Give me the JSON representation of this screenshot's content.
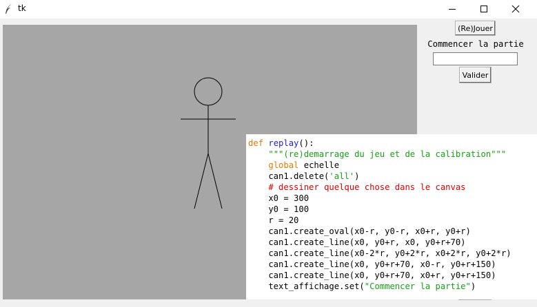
{
  "window": {
    "title": "tk"
  },
  "controls": {
    "replay_label": "(Re)Jouer",
    "status_text": "Commencer la partie",
    "entry_value": "",
    "validate_label": "Valider"
  },
  "code": {
    "lines": [
      [
        {
          "t": "def ",
          "c": "kw"
        },
        {
          "t": "replay",
          "c": "fn"
        },
        {
          "t": "():",
          "c": ""
        }
      ],
      [
        {
          "t": "    ",
          "c": ""
        },
        {
          "t": "\"\"\"(re)demarrage du jeu et de la calibration\"\"\"",
          "c": "str"
        }
      ],
      [
        {
          "t": "    ",
          "c": ""
        },
        {
          "t": "global",
          "c": "kw"
        },
        {
          "t": " echelle",
          "c": ""
        }
      ],
      [
        {
          "t": "    can1.delete(",
          "c": ""
        },
        {
          "t": "'all'",
          "c": "str"
        },
        {
          "t": ")",
          "c": ""
        }
      ],
      [
        {
          "t": "    ",
          "c": ""
        },
        {
          "t": "# dessiner quelque chose dans le canvas",
          "c": "cm"
        }
      ],
      [
        {
          "t": "    x0 = 300",
          "c": ""
        }
      ],
      [
        {
          "t": "    y0 = 100",
          "c": ""
        }
      ],
      [
        {
          "t": "    r = 20",
          "c": ""
        }
      ],
      [
        {
          "t": "    can1.create_oval(x0-r, y0-r, x0+r, y0+r)",
          "c": ""
        }
      ],
      [
        {
          "t": "    can1.create_line(x0, y0+r, x0, y0+r+70)",
          "c": ""
        }
      ],
      [
        {
          "t": "    can1.create_line(x0-2*r, y0+2*r, x0+2*r, y0+2*r)",
          "c": ""
        }
      ],
      [
        {
          "t": "    can1.create_line(x0, y0+r+70, x0-r, y0+r+150)",
          "c": ""
        }
      ],
      [
        {
          "t": "    can1.create_line(x0, y0+r+70, x0+r, y0+r+150)",
          "c": ""
        }
      ],
      [
        {
          "t": "    text_affichage.set(",
          "c": ""
        },
        {
          "t": "\"Commencer la partie\"",
          "c": "str"
        },
        {
          "t": ")",
          "c": ""
        }
      ]
    ]
  },
  "colors": {
    "canvas_bg": "#a6a6a6",
    "window_bg": "#f0f0f0",
    "keyword": "#e07b00",
    "function": "#1f1fcf",
    "string": "#15a115",
    "comment": "#dd0000"
  }
}
